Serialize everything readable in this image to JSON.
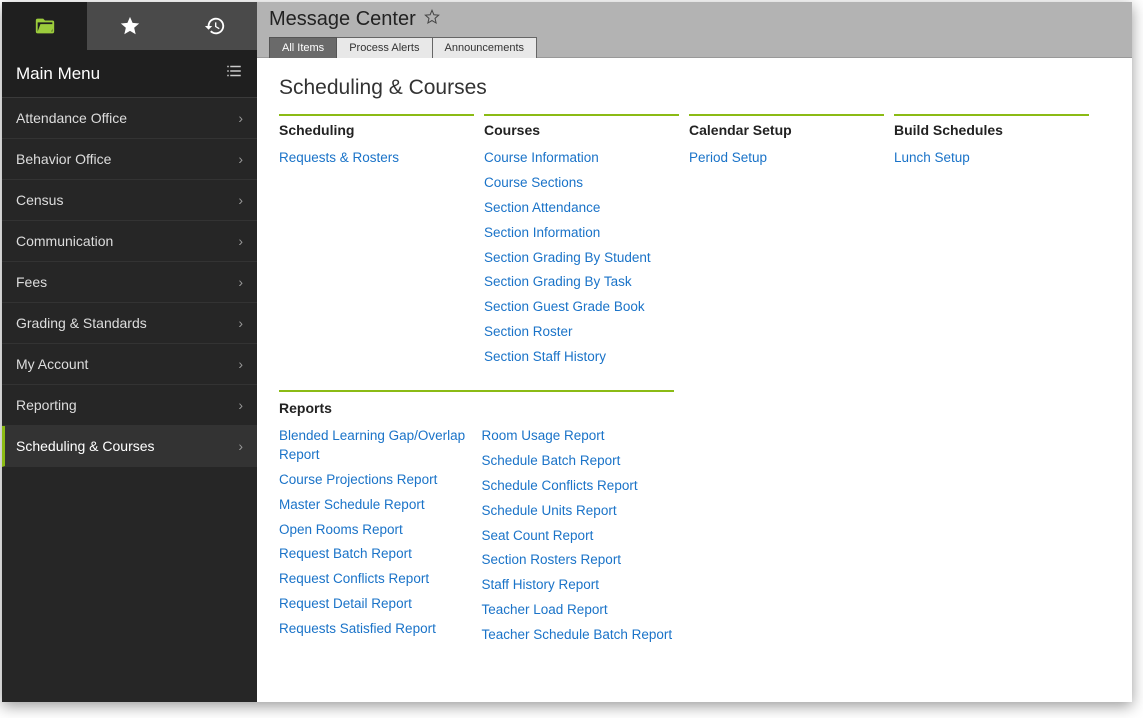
{
  "sidebar": {
    "main_menu_label": "Main Menu",
    "items": [
      {
        "label": "Attendance Office",
        "active": false
      },
      {
        "label": "Behavior Office",
        "active": false
      },
      {
        "label": "Census",
        "active": false
      },
      {
        "label": "Communication",
        "active": false
      },
      {
        "label": "Fees",
        "active": false
      },
      {
        "label": "Grading & Standards",
        "active": false
      },
      {
        "label": "My Account",
        "active": false
      },
      {
        "label": "Reporting",
        "active": false
      },
      {
        "label": "Scheduling & Courses",
        "active": true
      }
    ]
  },
  "header": {
    "title": "Message Center",
    "tabs": [
      {
        "label": "All Items",
        "active": true
      },
      {
        "label": "Process Alerts",
        "active": false
      },
      {
        "label": "Announcements",
        "active": false
      }
    ]
  },
  "content": {
    "heading": "Scheduling & Courses",
    "groups": [
      {
        "title": "Scheduling",
        "links": [
          "Requests & Rosters"
        ]
      },
      {
        "title": "Courses",
        "links": [
          "Course Information",
          "Course Sections",
          "Section Attendance",
          "Section Information",
          "Section Grading By Student",
          "Section Grading By Task",
          "Section Guest Grade Book",
          "Section Roster",
          "Section Staff History"
        ]
      },
      {
        "title": "Calendar Setup",
        "links": [
          "Period Setup"
        ]
      },
      {
        "title": "Build Schedules",
        "links": [
          "Lunch Setup"
        ]
      }
    ],
    "reports": {
      "title": "Reports",
      "col1": [
        "Blended Learning Gap/Overlap Report",
        "Course Projections Report",
        "Master Schedule Report",
        "Open Rooms Report",
        "Request Batch Report",
        "Request Conflicts Report",
        "Request Detail Report",
        "Requests Satisfied Report"
      ],
      "col2": [
        "Room Usage Report",
        "Schedule Batch Report",
        "Schedule Conflicts Report",
        "Schedule Units Report",
        "Seat Count Report",
        "Section Rosters Report",
        "Staff History Report",
        "Teacher Load Report",
        "Teacher Schedule Batch Report"
      ]
    }
  }
}
